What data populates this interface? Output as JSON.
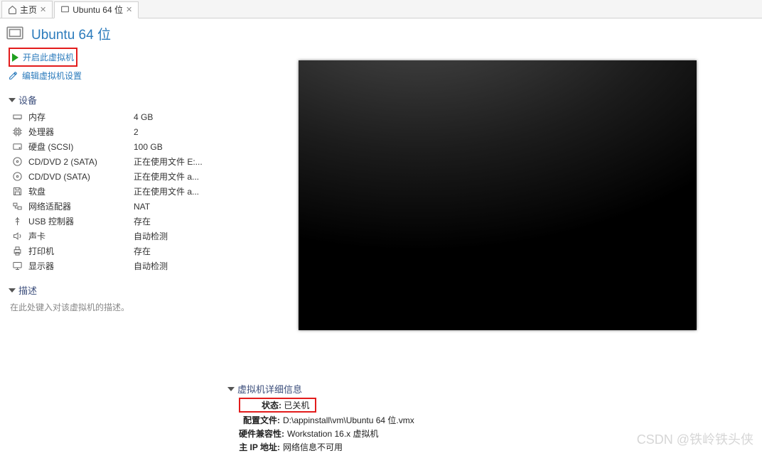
{
  "tabs": {
    "home": "主页",
    "vm": "Ubuntu 64 位"
  },
  "vm_title": "Ubuntu 64 位",
  "actions": {
    "power_on": "开启此虚拟机",
    "edit_settings": "编辑虚拟机设置"
  },
  "sections": {
    "devices": "设备",
    "description": "描述",
    "vm_detail": "虚拟机详细信息"
  },
  "devices": [
    {
      "icon": "memory-icon",
      "label": "内存",
      "value": "4 GB"
    },
    {
      "icon": "cpu-icon",
      "label": "处理器",
      "value": "2"
    },
    {
      "icon": "disk-icon",
      "label": "硬盘 (SCSI)",
      "value": "100 GB"
    },
    {
      "icon": "cd-icon",
      "label": "CD/DVD 2 (SATA)",
      "value": "正在使用文件 E:..."
    },
    {
      "icon": "cd-icon",
      "label": "CD/DVD (SATA)",
      "value": "正在使用文件 a..."
    },
    {
      "icon": "floppy-icon",
      "label": "软盘",
      "value": "正在使用文件 a..."
    },
    {
      "icon": "network-icon",
      "label": "网络适配器",
      "value": "NAT"
    },
    {
      "icon": "usb-icon",
      "label": "USB 控制器",
      "value": "存在"
    },
    {
      "icon": "sound-icon",
      "label": "声卡",
      "value": "自动检测"
    },
    {
      "icon": "printer-icon",
      "label": "打印机",
      "value": "存在"
    },
    {
      "icon": "display-icon",
      "label": "显示器",
      "value": "自动检测"
    }
  ],
  "description_placeholder": "在此处键入对该虚拟机的描述。",
  "details": {
    "state_label": "状态:",
    "state_value": "已关机",
    "config_label": "配置文件:",
    "config_value": "D:\\appinstall\\vm\\Ubuntu 64 位.vmx",
    "compat_label": "硬件兼容性:",
    "compat_value": "Workstation 16.x 虚拟机",
    "ip_label": "主 IP 地址:",
    "ip_value": "网络信息不可用"
  },
  "watermark": "CSDN @铁岭铁头侠"
}
